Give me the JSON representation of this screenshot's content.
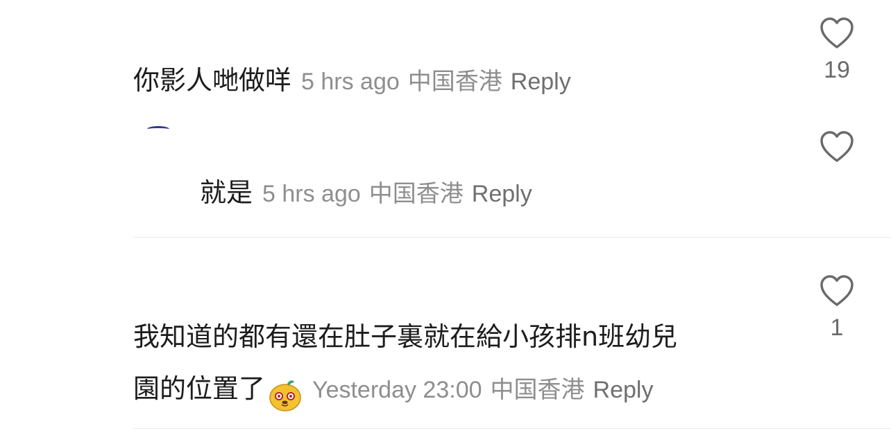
{
  "comments": [
    {
      "text": "你影人哋做咩",
      "time": "5 hrs ago",
      "location": "中国香港",
      "reply_label": "Reply",
      "like_count": "19"
    },
    {
      "text": "就是",
      "time": "5 hrs ago",
      "location": "中国香港",
      "reply_label": "Reply",
      "like_count": ""
    },
    {
      "text_line1": "我知道的都有還在肚子裏就在給小孩排n班幼兒",
      "text_line2": "園的位置了",
      "emoji": "smiling-face-emoji",
      "time": "Yesterday 23:00",
      "location": "中国香港",
      "reply_label": "Reply",
      "like_count": "1"
    }
  ],
  "colors": {
    "text": "#1c1c1c",
    "meta": "#8e8e8e",
    "divider": "#ececec"
  }
}
